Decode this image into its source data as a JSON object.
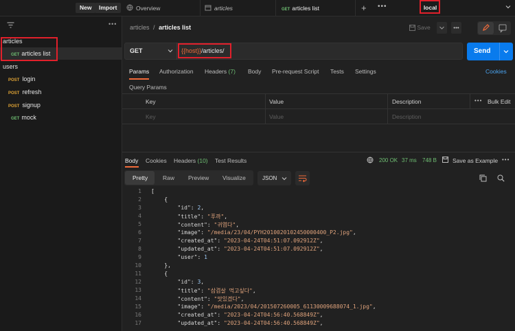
{
  "toolbar": {
    "new_label": "New",
    "import_label": "Import"
  },
  "tabs": [
    {
      "label": "Overview"
    },
    {
      "label": "articles"
    },
    {
      "method": "GET",
      "label": "articles list"
    }
  ],
  "environment": {
    "label": "local"
  },
  "sidebar": {
    "groups": [
      {
        "label": "articles",
        "items": [
          {
            "method": "GET",
            "label": "articles list"
          }
        ]
      },
      {
        "label": "users",
        "items": [
          {
            "method": "POST",
            "label": "login"
          },
          {
            "method": "POST",
            "label": "refresh"
          },
          {
            "method": "POST",
            "label": "signup"
          },
          {
            "method": "GET",
            "label": "mock"
          }
        ]
      }
    ]
  },
  "breadcrumb": {
    "parent": "articles",
    "sep": "/",
    "current": "articles list"
  },
  "save_label": "Save",
  "request": {
    "method": "GET",
    "url_var": "{{host}}",
    "url_path": "/articles/",
    "send_label": "Send"
  },
  "req_tabs": [
    "Params",
    "Authorization",
    "Headers",
    "Body",
    "Pre-request Script",
    "Tests",
    "Settings"
  ],
  "req_headers_count": "(7)",
  "cookies_label": "Cookies",
  "query_params": {
    "title": "Query Params",
    "columns": [
      "Key",
      "Value",
      "Description"
    ],
    "bulk_edit": "Bulk Edit",
    "placeholders": {
      "key": "Key",
      "value": "Value",
      "description": "Description"
    }
  },
  "resp_tabs": [
    "Body",
    "Cookies",
    "Headers",
    "Test Results"
  ],
  "resp_headers_count": "(10)",
  "status": {
    "code": "200 OK",
    "time": "37 ms",
    "size": "748 B",
    "save_example": "Save as Example"
  },
  "view_modes": [
    "Pretty",
    "Raw",
    "Preview",
    "Visualize"
  ],
  "format": "JSON",
  "code_lines": [
    "[",
    "    {",
    "        \"id\": 2,",
    "        \"title\": \"푸까\",",
    "        \"content\": \"귀엽다\",",
    "        \"image\": \"/media/23/04/PYH2010020102450000400_P2.jpg\",",
    "        \"created_at\": \"2023-04-24T04:51:07.092912Z\",",
    "        \"updated_at\": \"2023-04-24T04:51:07.092912Z\",",
    "        \"user\": 1",
    "    },",
    "    {",
    "        \"id\": 3,",
    "        \"title\": \"삼겹살 먹고싶다\",",
    "        \"content\": \"맛있겠다\",",
    "        \"image\": \"/media/2023/04/201507260005_61130009688074_1.jpg\",",
    "        \"created_at\": \"2023-04-24T04:56:40.568849Z\",",
    "        \"updated_at\": \"2023-04-24T04:56:40.568849Z\","
  ],
  "line_numbers": [
    "1",
    "2",
    "3",
    "4",
    "5",
    "6",
    "7",
    "8",
    "9",
    "10",
    "11",
    "12",
    "13",
    "14",
    "15",
    "16",
    "17"
  ]
}
